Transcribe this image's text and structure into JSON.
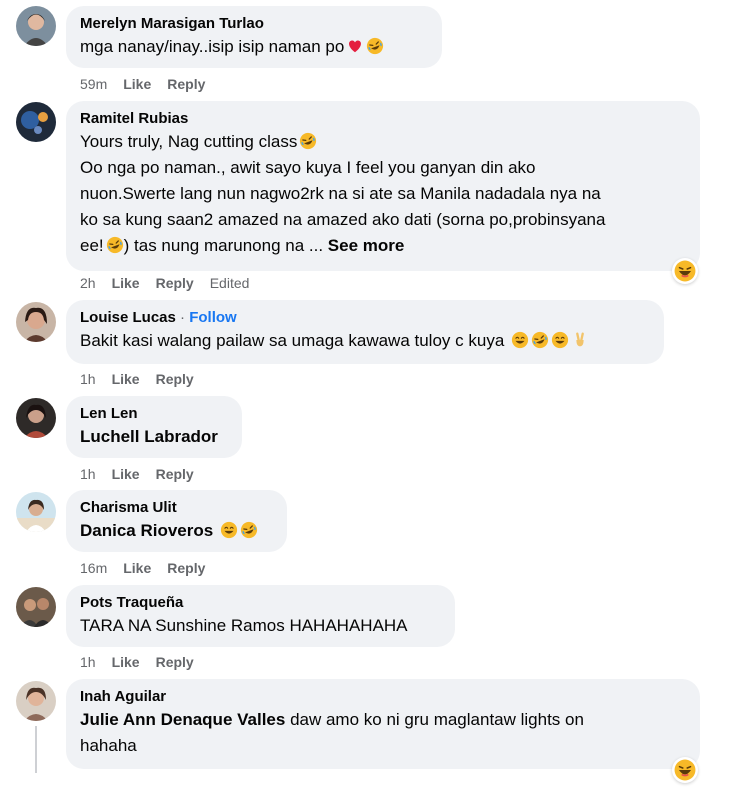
{
  "comments": [
    {
      "author": "Merelyn Marasigan Turlao",
      "lines": [
        "mga nanay/inay..isip isip naman po"
      ],
      "time": "59m",
      "like": "Like",
      "reply": "Reply"
    },
    {
      "author": "Ramitel Rubias",
      "line1": "Yours truly, Nag cutting class",
      "line2": "Oo nga po naman., awit sayo kuya I feel you ganyan din ako",
      "line3": "nuon.Swerte lang nun nagwo2rk na si ate sa Manila nadadala nya na",
      "line4": "ko sa kung saan2 amazed na amazed ako dati (sorna po,probinsyana",
      "line5a": "ee!",
      "line5b": ") tas nung marunong na ...",
      "see_more": "See more",
      "time": "2h",
      "like": "Like",
      "reply": "Reply",
      "edited": "Edited"
    },
    {
      "author": "Louise Lucas",
      "separator": "·",
      "follow": "Follow",
      "text": "Bakit kasi walang pailaw sa umaga kawawa tuloy c kuya",
      "time": "1h",
      "like": "Like",
      "reply": "Reply"
    },
    {
      "author": "Len Len",
      "tag": "Luchell Labrador",
      "time": "1h",
      "like": "Like",
      "reply": "Reply"
    },
    {
      "author": "Charisma Ulit",
      "tag": "Danica Rioveros",
      "time": "16m",
      "like": "Like",
      "reply": "Reply"
    },
    {
      "author": "Pots Traqueña",
      "text": "TARA NA Sunshine Ramos HAHAHAHAHA",
      "time": "1h",
      "like": "Like",
      "reply": "Reply"
    },
    {
      "author": "Inah Aguilar",
      "tag": "Julie Ann Denaque Valles",
      "text1": "daw amo ko ni gru maglantaw lights on",
      "text2": "hahaha"
    }
  ],
  "colors": {
    "bubble": "#f0f2f5",
    "meta": "#65676b",
    "link": "#1877f2",
    "heart": "#e41e3f",
    "emoji": "#f7b928"
  },
  "icons": {
    "heart": "red-heart-icon",
    "laugh": "rolling-laughing-emoji-icon",
    "smile": "grinning-emoji-icon",
    "peace": "victory-hand-emoji-icon",
    "haha_reaction": "haha-reaction-icon"
  }
}
